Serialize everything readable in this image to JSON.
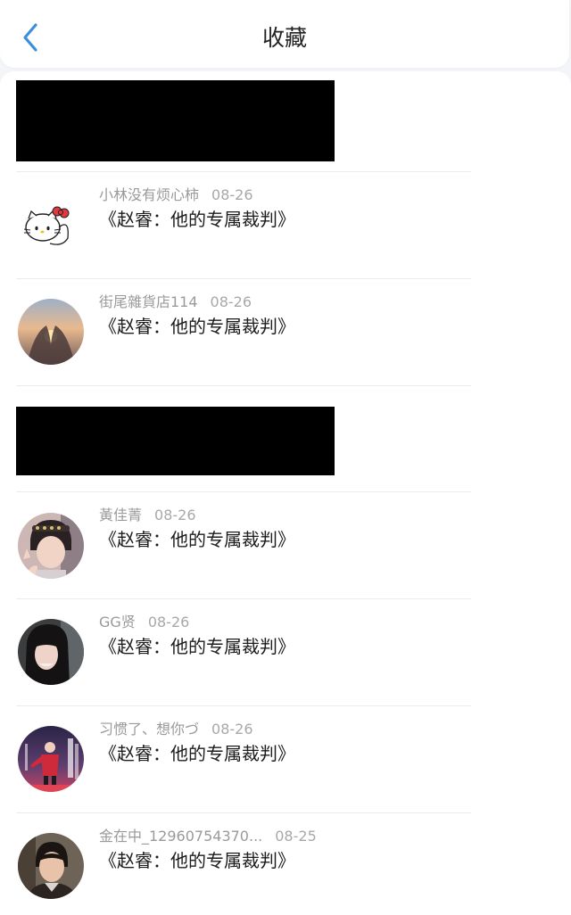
{
  "header": {
    "title": "收藏",
    "back_icon": "chevron-left-icon",
    "accent_color": "#3b8fe0"
  },
  "items": [
    {
      "type": "redacted"
    },
    {
      "type": "comment",
      "user": "小林没有烦心柿",
      "date": "08-26",
      "text": "《赵睿：他的专属裁判》",
      "avatar_icon": "hello-kitty-avatar"
    },
    {
      "type": "comment",
      "user": "街尾雜貨店114",
      "date": "08-26",
      "text": "《赵睿：他的专属裁判》",
      "avatar_icon": "sunset-hands-avatar"
    },
    {
      "type": "redacted"
    },
    {
      "type": "comment",
      "user": "黃佳菁",
      "date": "08-26",
      "text": "《赵睿：他的专属裁判》",
      "avatar_icon": "girl-peace-sign-avatar"
    },
    {
      "type": "comment",
      "user": "GG贤",
      "date": "08-26",
      "text": "《赵睿：他的专属裁判》",
      "avatar_icon": "girl-selfie-avatar"
    },
    {
      "type": "comment",
      "user": "习惯了、想你づ",
      "date": "08-26",
      "text": "《赵睿：他的专属裁判》",
      "avatar_icon": "stage-performer-avatar"
    },
    {
      "type": "comment",
      "user": "金在中_12960754370...",
      "date": "08-25",
      "text": "《赵睿：他的专属裁判》",
      "avatar_icon": "man-portrait-avatar"
    }
  ]
}
